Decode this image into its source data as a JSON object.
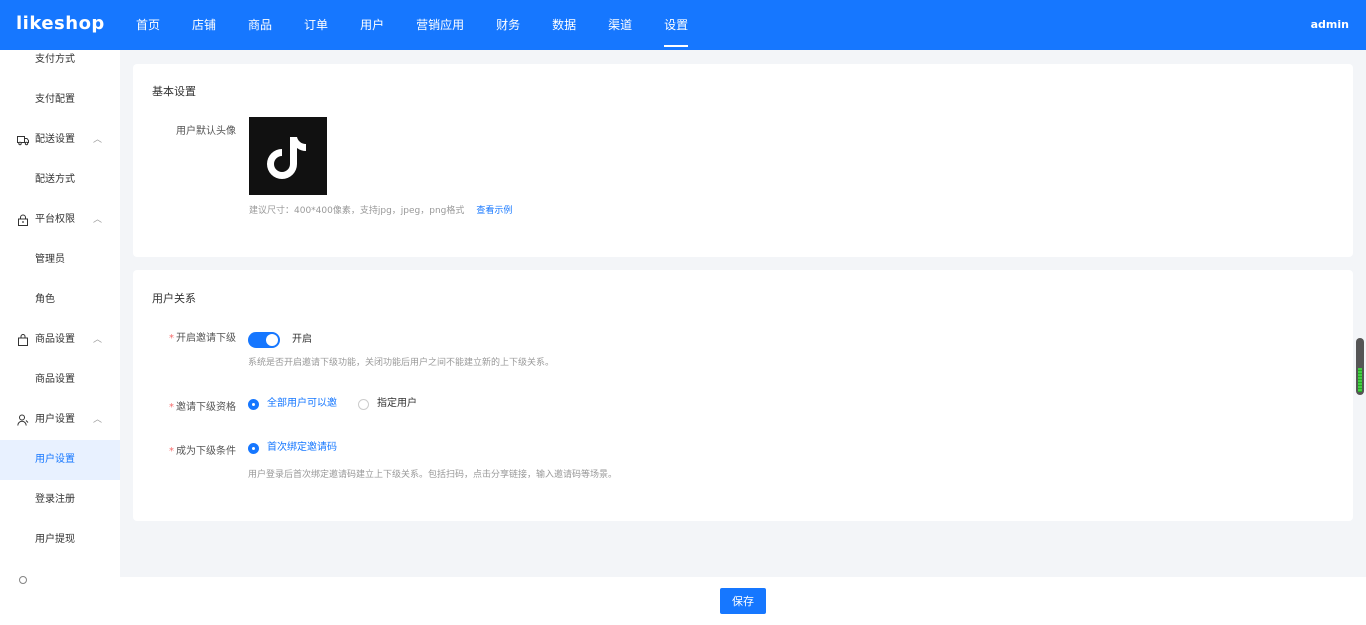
{
  "app": {
    "logo": "likeshop",
    "user": "admin"
  },
  "topnav": [
    {
      "label": "首页"
    },
    {
      "label": "店铺"
    },
    {
      "label": "商品"
    },
    {
      "label": "订单"
    },
    {
      "label": "用户"
    },
    {
      "label": "营销应用"
    },
    {
      "label": "财务"
    },
    {
      "label": "数据"
    },
    {
      "label": "渠道"
    },
    {
      "label": "设置",
      "active": true
    }
  ],
  "sidebar": {
    "items": [
      {
        "label": "支付方式"
      },
      {
        "label": "支付配置"
      },
      {
        "label": "配送设置",
        "icon": "truck-icon"
      },
      {
        "label": "配送方式"
      },
      {
        "label": "平台权限",
        "icon": "lock-icon"
      },
      {
        "label": "管理员"
      },
      {
        "label": "角色"
      },
      {
        "label": "商品设置",
        "icon": "bag-icon"
      },
      {
        "label": "商品设置"
      },
      {
        "label": "用户设置",
        "icon": "user-icon"
      },
      {
        "label": "用户设置",
        "active": true
      },
      {
        "label": "登录注册"
      },
      {
        "label": "用户提现"
      }
    ]
  },
  "basic": {
    "title": "基本设置",
    "avatar_label": "用户默认头像",
    "avatar_hint": "建议尺寸：400*400像素，支持jpg，jpeg，png格式",
    "avatar_link": "查看示例"
  },
  "relation": {
    "title": "用户关系",
    "invite_label": "开启邀请下级",
    "invite_switch_text": "开启",
    "invite_hint": "系统是否开启邀请下级功能，关闭功能后用户之间不能建立新的上下级关系。",
    "qualification_label": "邀请下级资格",
    "qualification_options": [
      "全部用户可以邀",
      "指定用户"
    ],
    "condition_label": "成为下级条件",
    "condition_option": "首次绑定邀请码",
    "condition_hint": "用户登录后首次绑定邀请码建立上下级关系。包括扫码，点击分享链接，输入邀请码等场景。"
  },
  "footer": {
    "save_label": "保存"
  }
}
